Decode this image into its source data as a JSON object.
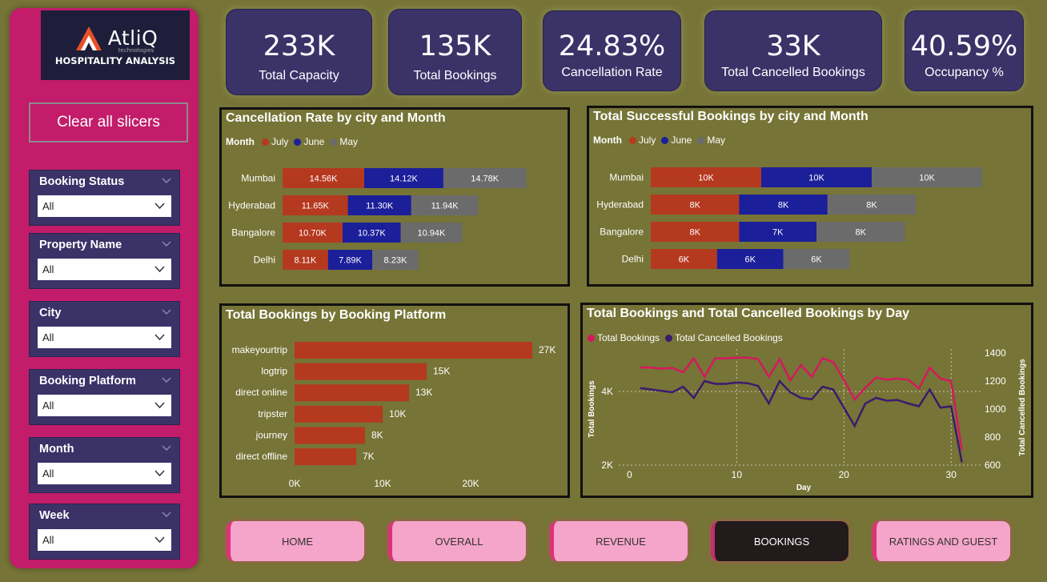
{
  "logo": {
    "brand": "AtliQ",
    "sub": "technologies",
    "caption": "HOSPITALITY ANALYSIS"
  },
  "sidebar": {
    "clear_label": "Clear all slicers",
    "slicers": [
      {
        "title": "Booking Status",
        "value": "All"
      },
      {
        "title": "Property Name",
        "value": "All"
      },
      {
        "title": "City",
        "value": "All"
      },
      {
        "title": "Booking Platform",
        "value": "All"
      },
      {
        "title": "Month",
        "value": "All"
      },
      {
        "title": "Week",
        "value": "All"
      }
    ]
  },
  "kpis": [
    {
      "value": "233K",
      "label": "Total Capacity"
    },
    {
      "value": "135K",
      "label": "Total Bookings"
    },
    {
      "value": "24.83%",
      "label": "Cancellation Rate"
    },
    {
      "value": "33K",
      "label": "Total Cancelled Bookings"
    },
    {
      "value": "40.59%",
      "label": "Occupancy %"
    }
  ],
  "colors": {
    "july": "#b5391f",
    "june": "#1b1f9a",
    "may": "#6b6b6b",
    "bookings_line": "#d4195f",
    "cancel_line": "#3c1a6e"
  },
  "chart_data": [
    {
      "type": "bar",
      "orientation": "horizontal-stacked",
      "title": "Cancellation Rate by city and Month",
      "legend_title": "Month",
      "categories": [
        "Mumbai",
        "Hyderabad",
        "Bangalore",
        "Delhi"
      ],
      "series": [
        {
          "name": "July",
          "values": [
            14.56,
            11.65,
            10.7,
            8.11
          ],
          "labels": [
            "14.56K",
            "11.65K",
            "10.70K",
            "8.11K"
          ]
        },
        {
          "name": "June",
          "values": [
            14.12,
            11.3,
            10.37,
            7.89
          ],
          "labels": [
            "14.12K",
            "11.30K",
            "10.37K",
            "7.89K"
          ]
        },
        {
          "name": "May",
          "values": [
            14.78,
            11.94,
            10.94,
            8.23
          ],
          "labels": [
            "14.78K",
            "11.94K",
            "10.94K",
            "8.23K"
          ]
        }
      ]
    },
    {
      "type": "bar",
      "orientation": "horizontal-stacked",
      "title": "Total Successful Bookings by city and Month",
      "legend_title": "Month",
      "categories": [
        "Mumbai",
        "Hyderabad",
        "Bangalore",
        "Delhi"
      ],
      "series": [
        {
          "name": "July",
          "values": [
            10,
            8,
            8,
            6
          ],
          "labels": [
            "10K",
            "8K",
            "8K",
            "6K"
          ]
        },
        {
          "name": "June",
          "values": [
            10,
            8,
            7,
            6
          ],
          "labels": [
            "10K",
            "8K",
            "7K",
            "6K"
          ]
        },
        {
          "name": "May",
          "values": [
            10,
            8,
            8,
            6
          ],
          "labels": [
            "10K",
            "8K",
            "8K",
            "6K"
          ]
        }
      ]
    },
    {
      "type": "bar",
      "orientation": "horizontal",
      "title": "Total Bookings by Booking Platform",
      "categories": [
        "makeyourtrip",
        "logtrip",
        "direct online",
        "tripster",
        "journey",
        "direct offline"
      ],
      "values": [
        27,
        15,
        13,
        10,
        8,
        7
      ],
      "labels": [
        "27K",
        "15K",
        "13K",
        "10K",
        "8K",
        "7K"
      ],
      "xticks": [
        "0K",
        "10K",
        "20K"
      ],
      "xlim": [
        0,
        27
      ]
    },
    {
      "type": "line",
      "title": "Total Bookings and Total Cancelled Bookings by Day",
      "xlabel": "Day",
      "ylabel": "Total Bookings",
      "y2label": "Total Cancelled Bookings",
      "xticks": [
        "0",
        "10",
        "20",
        "30"
      ],
      "yticks": [
        "2K",
        "4K"
      ],
      "y2ticks": [
        "600",
        "800",
        "1000",
        "1200",
        "1400"
      ],
      "xlim": [
        -1,
        32
      ],
      "ylim": [
        2,
        5
      ],
      "y2lim": [
        600,
        1400
      ],
      "x": [
        1,
        2,
        3,
        4,
        5,
        6,
        7,
        8,
        9,
        10,
        11,
        12,
        13,
        14,
        15,
        16,
        17,
        18,
        19,
        20,
        21,
        22,
        23,
        24,
        25,
        26,
        27,
        28,
        29,
        30,
        31
      ],
      "series": [
        {
          "name": "Total Bookings",
          "axis": "left",
          "values": [
            4.65,
            4.65,
            4.62,
            4.64,
            4.52,
            4.9,
            4.4,
            4.9,
            4.9,
            4.92,
            4.92,
            4.88,
            4.4,
            4.88,
            4.3,
            4.72,
            4.4,
            4.9,
            4.8,
            4.32,
            3.78,
            4.1,
            4.38,
            4.32,
            4.35,
            4.32,
            4.08,
            4.65,
            4.35,
            4.28,
            2.42
          ]
        },
        {
          "name": "Total Cancelled Bookings",
          "axis": "right",
          "values": [
            1150,
            1140,
            1130,
            1120,
            1160,
            1080,
            1200,
            1180,
            1180,
            1190,
            1185,
            1165,
            1040,
            1200,
            1120,
            1080,
            1070,
            1160,
            1140,
            1010,
            880,
            1040,
            1080,
            1060,
            1065,
            1040,
            1020,
            1140,
            1010,
            1020,
            620
          ]
        }
      ]
    }
  ],
  "nav": [
    {
      "label": "HOME"
    },
    {
      "label": "OVERALL"
    },
    {
      "label": "REVENUE"
    },
    {
      "label": "BOOKINGS",
      "active": true
    },
    {
      "label": "RATINGS AND GUEST"
    }
  ]
}
